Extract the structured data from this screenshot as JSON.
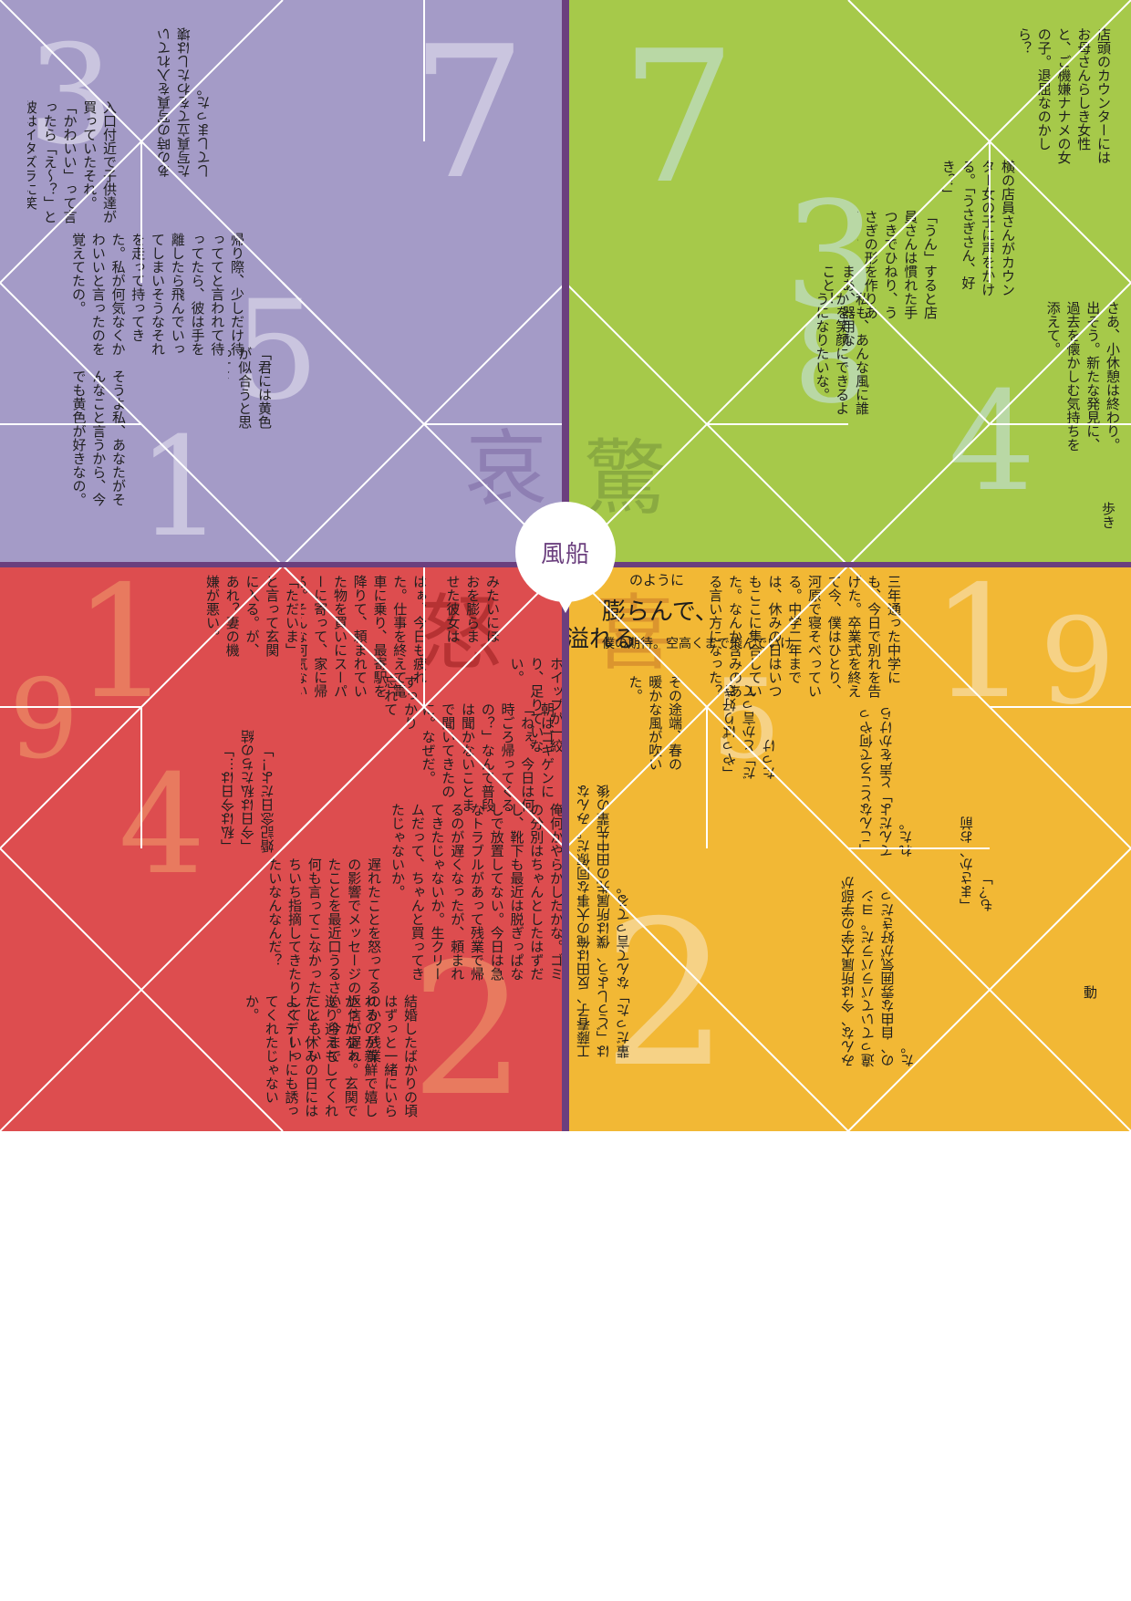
{
  "title": "風船",
  "quadrants": {
    "purple": {
      "color": "#a49bc7",
      "numbers": [
        "7",
        "3",
        "5",
        "1"
      ],
      "kanji": "哀",
      "texts": [
        "入口付近で子供達が買っていたそれ。「かわいい」って言ったら「え～？」と彼はイタズラに笑う。",
        "帰り際、少しだけ待っててと言われて待ってたら、彼は手を離したら飛んでいってしまいそうなそれを走って持ってきた。私が何気なくかわいいと言ったのを覚えてたの。",
        "そうよ私、あなたがそんなこと言うから、今でも黄色が好きなの。",
        "「君には黄色が似合うと思って」",
        "あの時の写真を入れていた写真立てをわたしは壊してしまった。"
      ]
    },
    "green": {
      "color": "#a6c94a",
      "numbers": [
        "7",
        "3",
        "4",
        "8"
      ],
      "kanji": "驚",
      "texts": [
        "店頭のカウンターにはお母さんらしき女性と、ご機嫌ナナメの女の子。退屈なのかしら？",
        "横の店員さんがカウンター女の子に声をかける。「うさぎさん、好き？」",
        "「うん」すると店員さんは慣れた手つきでひねり、うさぎの形を作りあげた。",
        "まあ、器用なこと！",
        "私も、あんな風に誰かを笑顔にできるようになりたいな。",
        "さあ、小休憩は終わり。出そう。新たな発見に、過去を懐かしむ気持ちを添えて。",
        "歩き"
      ]
    },
    "red": {
      "color": "#dd4d4f",
      "numbers": [
        "1",
        "2",
        "4",
        "9"
      ],
      "kanji": "怒",
      "texts": [
        "はぁ、今日も疲れた。仕事を終えて電車に乗り、最寄駅を降りて、頼まれていた物を買いにスーパーに寄って、家に帰る。そんな何気ない日常。",
        "「ただいま」と言って玄関に入る。が、あれ？妻の機嫌が悪い。",
        "朝はゴキゲンに「ねぇ、今日は何時ごろ帰ってくるの？」なんて普段は聞かないことまで聞いてきたのに。なぜだ。",
        "ホイップが一絞り、足りていない。",
        "俺何かやらかしたかな。ゴミの分別はちゃんとしたはずだし、靴下も最近は脱ぎっぱなしで放置してない。今日は急なトラブルがあって残業で帰るのが遅くなったが、頼まれてきたじゃないか。生クリームだって、ちゃんと買ってきたじゃないか。",
        "遅れたことを怒ってるのか？残業の影響でメッセージの返信が遅れたことを最近口うるさい。今まで何も言ってこなかったことも、いちいち指摘してきたりして…いったいなんなんだ？",
        "結婚したばかりの頃はずっと一緒にいられるのが新鮮で嬉しかったなぁ。玄関で送り迎えもしてくれたし、休みの日にはよくデートにも誘ってくれたじゃないか。",
        "「私は今日は…」「今日は私たちの結婚記念日だよ！」",
        "みたいにほおを膨らませた彼女は",
        "すっかり忘れてた！"
      ]
    },
    "yellow": {
      "color": "#f2b835",
      "numbers": [
        "1",
        "2",
        "5",
        "9"
      ],
      "kanji": "喜",
      "texts": [
        "三年通った中学にも、今日で別れを告げた。卒業式を終えて今、僕はひとり、河原で寝そべっている。中学二年までは、休みの日はいつもここに集合していた。なんか含みのある言い方になった？",
        "その途端、春の暖かな風が吹いた。",
        "溢れる",
        "膨らんで、",
        "のように",
        "僕の期待。空高くまで飛んでいけ",
        "工藤春子、反田は俺の大事な同僚だ。みんなは「どうしよう、僕は所属先の田中先輩の後輩だった」なんて言ってる。",
        "みんな、今は所属大学の学部が違っていてバラバラだ。ヨシの、自由な雰囲気が好きだった。",
        "「やっぱり好きだ」とか言ってたっけ",
        "「こんなところで何やってんだよ」と声をかけられた。",
        "「まさか、お前も？」",
        "動"
      ]
    }
  }
}
